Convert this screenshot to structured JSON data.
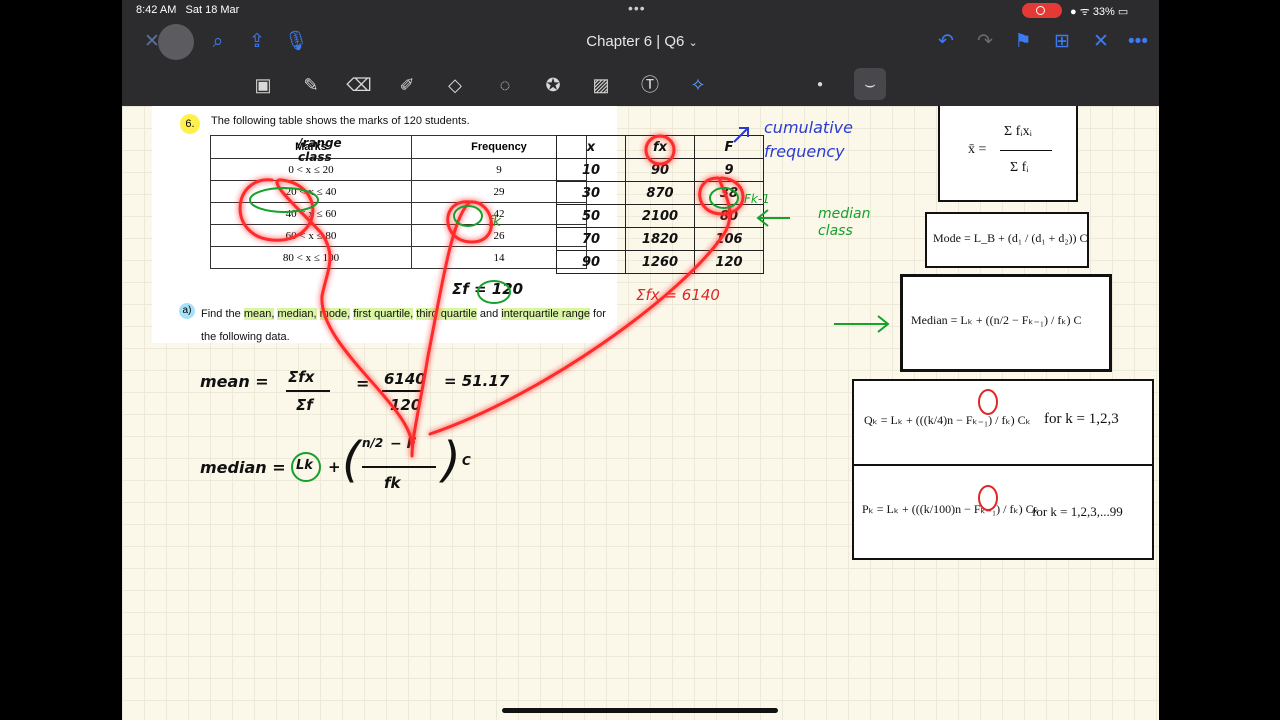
{
  "status": {
    "time": "8:42 AM",
    "date": "Sat 18 Mar",
    "battery": "33%"
  },
  "nav": {
    "title": "Chapter 6 | Q6",
    "title_chevron": "⌄"
  },
  "question": {
    "number": "6.",
    "text": "The following table shows the marks of 120 students.",
    "col_marks": "Marks",
    "col_frequency": "Frequency",
    "rows": [
      {
        "range": "0 < x ≤ 20",
        "freq": "9"
      },
      {
        "range": "20 < x ≤ 40",
        "freq": "29"
      },
      {
        "range": "40 < x ≤ 60",
        "freq": "42"
      },
      {
        "range": "60 < x ≤ 80",
        "freq": "26"
      },
      {
        "range": "80 < x ≤ 100",
        "freq": "14"
      }
    ],
    "part_label": "a)",
    "part_text_1": "Find the",
    "part_words": [
      "mean,",
      "median,",
      "mode,",
      "first quartile,",
      "third quartile"
    ],
    "part_and": "and",
    "part_iqr": "interquartile range",
    "part_text_2": "for the following data."
  },
  "handwritten_table": {
    "headers": [
      "x",
      "fx",
      "F"
    ],
    "rows": [
      [
        "10",
        "90",
        "9"
      ],
      [
        "30",
        "870",
        "38"
      ],
      [
        "50",
        "2100",
        "80"
      ],
      [
        "70",
        "1820",
        "106"
      ],
      [
        "90",
        "1260",
        "120"
      ]
    ]
  },
  "notes": {
    "range_class": "/range class",
    "cumulative": "cumulative frequency",
    "median_class": "median class",
    "fk": "fk",
    "sigma_f": "Σf = 120",
    "sigma_fx": "Σfx = 6140",
    "f_k_minus_1": "Fk-1",
    "mean_label": "mean =",
    "mean_frac_num": "Σfx",
    "mean_frac_den": "Σf",
    "mean_eq": "=",
    "mean_num": "6140",
    "mean_den": "120",
    "mean_result": "= 51.17",
    "median_label": "median =",
    "lk": "Lk",
    "plus": "+",
    "n2": "n/2",
    "minus_f": "− F",
    "c": "C"
  },
  "formulas": {
    "mean_lhs": "x̄ =",
    "mean_num": "Σ fᵢxᵢ",
    "mean_den": "Σ fᵢ",
    "mode": "Mode = L_B + (d₁ / (d₁ + d₂)) C",
    "median": "Median = Lₖ + ((n/2 − Fₖ₋₁) / fₖ) C",
    "quartile": "Qₖ = Lₖ + (((k/4)n − Fₖ₋₁) / fₖ) Cₖ",
    "quartile_for": "for  k = 1,2,3",
    "percentile": "Pₖ = Lₖ + (((k/100)n − Fₖ₋₁) / fₖ) Cₖ",
    "percentile_for": "for  k = 1,2,3,...99"
  },
  "colors": {
    "red_ink": "#e02626",
    "green_ink": "#16a02c",
    "blue_ink": "#2a3bd1",
    "accent": "#3d7bf5"
  }
}
